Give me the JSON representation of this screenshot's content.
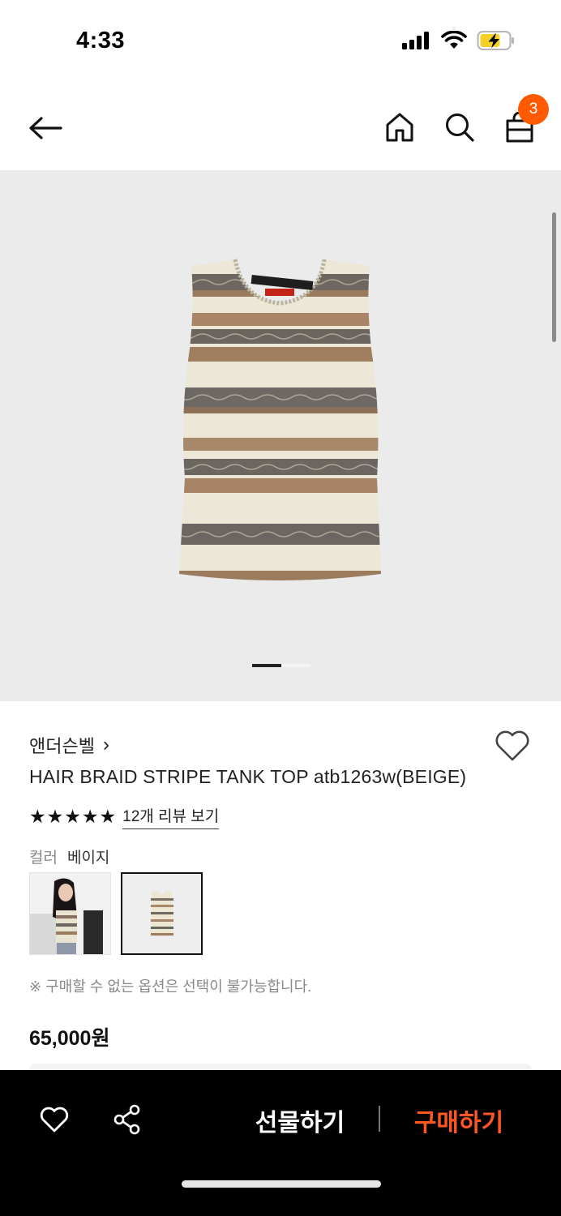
{
  "status_bar": {
    "time": "4:33"
  },
  "header": {
    "cart_count": "3"
  },
  "gallery": {
    "current_page": 1,
    "total_pages": 2
  },
  "product": {
    "brand": "앤더슨벨",
    "brand_chevron": "›",
    "title": "HAIR BRAID STRIPE TANK TOP atb1263w(BEIGE)",
    "rating": 5,
    "review_link": "12개 리뷰 보기",
    "color_label": "컬러",
    "color_value": "베이지",
    "notice": "※ 구매할 수 없는 옵션은 선택이 불가능합니다.",
    "price": "65,000원"
  },
  "bottom_bar": {
    "gift_label": "선물하기",
    "buy_label": "구매하기"
  },
  "colors": {
    "accent": "#ff5a00",
    "buy": "#ff5722",
    "image_bg": "#ebebeb"
  },
  "icons": [
    "back-arrow-icon",
    "home-icon",
    "search-icon",
    "shopping-bag-icon",
    "heart-icon",
    "share-icon",
    "star-icon",
    "chevron-right-icon"
  ]
}
